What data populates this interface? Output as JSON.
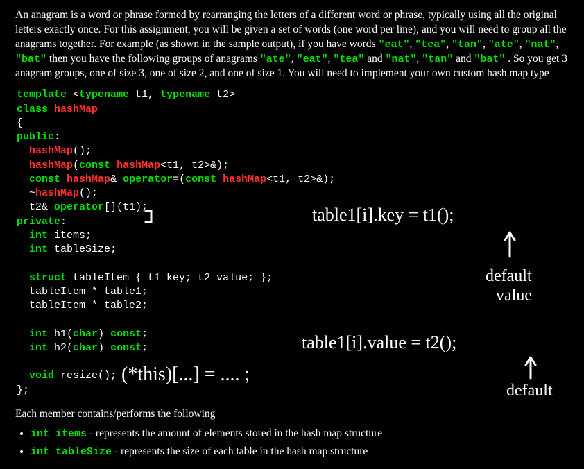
{
  "intro": {
    "pre1": "An anagram is a word or phrase formed by rearranging the letters of a different word or phrase, typically using all the original letters exactly once. For this assignment, you will be given a set of words (one word per line), and you will need to group all the anagrams together. For example (as shown in the sample output), if you have words ",
    "w1": "\"eat\"",
    "w2": "\"tea\"",
    "w3": "\"tan\"",
    "w4": "\"ate\"",
    "w5": "\"nat\"",
    "w6": "\"bat\"",
    "mid1": " then you have the following groups of anagrams ",
    "g1": "\"ate\"",
    "g2": "\"eat\"",
    "g3": "\"tea\"",
    "and1": " and ",
    "g4": "\"nat\"",
    "g5": "\"tan\"",
    "and2": " and ",
    "g6": "\"bat\"",
    "post1": ". So you get 3 anagram groups, one of size 3, one of size 2, and one of size 1. You will need to implement your own custom hash map type"
  },
  "code": {
    "l1a": "template",
    "l1b": " <",
    "l1c": "typename",
    "l1d": " t1, ",
    "l1e": "typename",
    "l1f": " t2>",
    "l2a": "class",
    "l2b": " ",
    "l2c": "hashMap",
    "l3": "{",
    "l4a": "public",
    "l4b": ":",
    "l5a": "  ",
    "l5b": "hashMap",
    "l5c": "();",
    "l6a": "  ",
    "l6b": "hashMap",
    "l6c": "(",
    "l6d": "const",
    "l6e": " ",
    "l6f": "hashMap",
    "l6g": "<t1, t2>&);",
    "l7a": "  ",
    "l7b": "const",
    "l7c": " ",
    "l7d": "hashMap",
    "l7e": "& ",
    "l7f": "operator",
    "l7g": "=(",
    "l7h": "const",
    "l7i": " ",
    "l7j": "hashMap",
    "l7k": "<t1, t2>&);",
    "l8a": "  ~",
    "l8b": "hashMap",
    "l8c": "();",
    "l9a": "  t2& ",
    "l9b": "operator",
    "l9c": "[](t1);",
    "l10a": "private",
    "l10b": ":",
    "l11a": "  ",
    "l11b": "int",
    "l11c": " items;",
    "l12a": "  ",
    "l12b": "int",
    "l12c": " tableSize;",
    "blank1": "",
    "l13a": "  ",
    "l13b": "struct",
    "l13c": " tableItem { t1 key; t2 value; };",
    "l14": "  tableItem * table1;",
    "l15": "  tableItem * table2;",
    "blank2": "",
    "l16a": "  ",
    "l16b": "int",
    "l16c": " h1(",
    "l16d": "char",
    "l16e": ") ",
    "l16f": "const",
    "l16g": ";",
    "l17a": "  ",
    "l17b": "int",
    "l17c": " h2(",
    "l17d": "char",
    "l17e": ") ",
    "l17f": "const",
    "l17g": ";",
    "blank3": "",
    "l18a": "  ",
    "l18b": "void",
    "l18c": " resize();",
    "l19": "};"
  },
  "after": "Each member contains/performs the following",
  "members": {
    "m1code": "int items",
    "m1text": " - represents the amount of elements stored in the hash map structure",
    "m2code": "int tableSize",
    "m2text": " - represents the size of each table in the hash map structure"
  },
  "handwriting": {
    "h1": "table1[i].key = t1();",
    "h2": "default value",
    "h3": "table1[i].value = t2();",
    "h4": "default",
    "h5": "(*this)[...] = .... ;"
  }
}
